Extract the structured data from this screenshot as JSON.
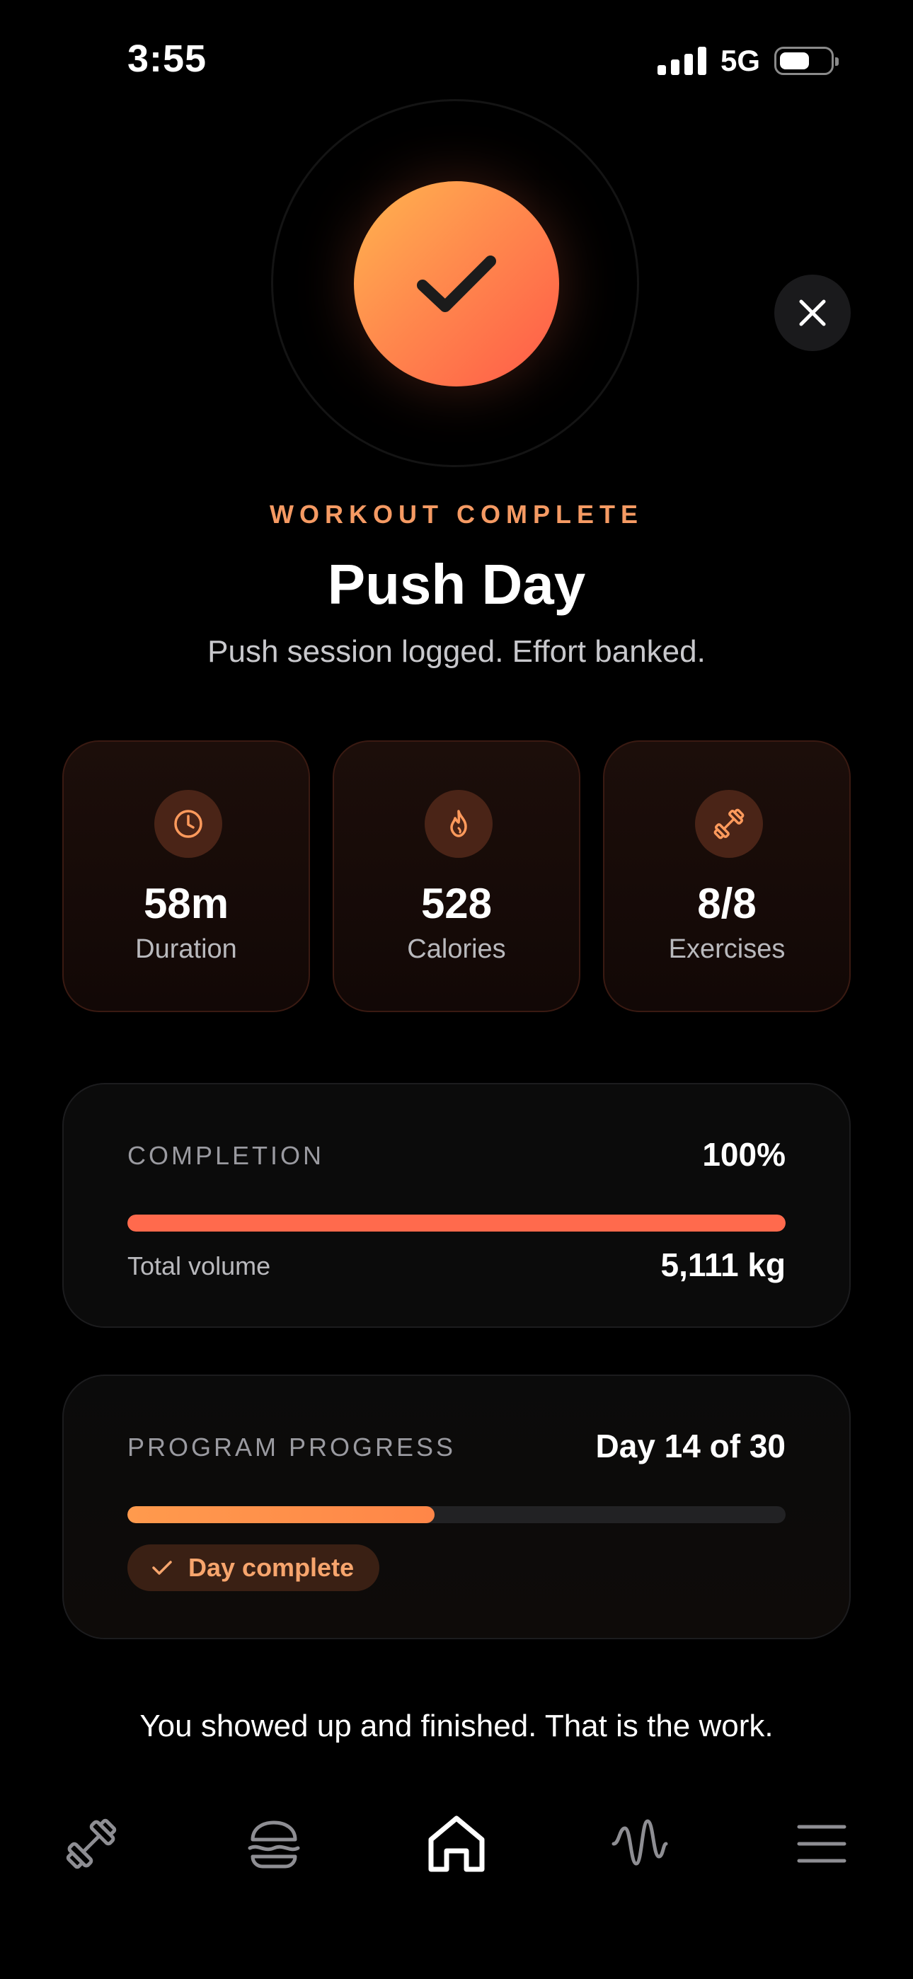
{
  "status_bar": {
    "time": "3:55",
    "network": "5G",
    "battery_level": 0.6
  },
  "hero": {
    "icon": "checkmark-icon",
    "close_icon": "close-icon"
  },
  "header": {
    "eyebrow": "WORKOUT COMPLETE",
    "title": "Push Day",
    "subtitle": "Push session logged. Effort banked."
  },
  "stats": [
    {
      "icon": "clock-icon",
      "value": "58m",
      "label": "Duration"
    },
    {
      "icon": "flame-icon",
      "value": "528",
      "label": "Calories"
    },
    {
      "icon": "dumbbell-icon",
      "value": "8/8",
      "label": "Exercises"
    }
  ],
  "completion": {
    "label": "COMPLETION",
    "value": "100%",
    "progress": 1.0,
    "volume_label": "Total volume",
    "volume_value": "5,111 kg"
  },
  "program": {
    "label": "PROGRAM PROGRESS",
    "value": "Day 14 of 30",
    "progress": 0.467,
    "badge_label": "Day complete"
  },
  "motto": "You showed up and finished. That is the work.",
  "tab_bar": [
    {
      "icon": "dumbbell-icon",
      "active": false
    },
    {
      "icon": "burger-food-icon",
      "active": false
    },
    {
      "icon": "home-icon",
      "active": true
    },
    {
      "icon": "activity-wave-icon",
      "active": false
    },
    {
      "icon": "menu-icon",
      "active": false
    }
  ],
  "colors": {
    "accent": "#f59a63",
    "completion_bar": "#ff6a4d",
    "program_bar": "#ff9a4d",
    "badge_text": "#f7a56d"
  }
}
